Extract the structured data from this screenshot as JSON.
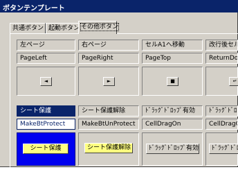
{
  "window": {
    "title": "ボタンテンプレート"
  },
  "tabs": [
    {
      "label": "共通ボタン",
      "active": false
    },
    {
      "label": "起動ボタン",
      "active": false
    },
    {
      "label": "その他ボタン",
      "active": true
    }
  ],
  "columns": [
    {
      "title": "左ページ",
      "macro": "PageLeft",
      "icon": "arrow-left-icon",
      "glyph": "◄"
    },
    {
      "title": "右ページ",
      "macro": "PageRight",
      "icon": "arrow-right-icon",
      "glyph": "►"
    },
    {
      "title": "セルA1へ移動",
      "macro": "PageTop",
      "icon": "square-stop-icon",
      "glyph": "■"
    },
    {
      "title": "改行後セル",
      "macro": "ReturnDow",
      "icon": "return-down-icon",
      "glyph": "↵"
    }
  ],
  "row2": [
    {
      "title": "シート保護",
      "macro": "MakeBtProtect",
      "button": "シート保護"
    },
    {
      "title": "シート保護解除",
      "macro": "MakeBtUnProtect",
      "button": "シート保護解除"
    },
    {
      "title": "ﾄﾞﾗｯｸﾞﾄﾞﾛｯﾌﾟ有効",
      "macro": "CellDragOn",
      "button": "ﾄﾞﾗｯｸﾞﾄﾞﾛｯﾌﾟ有効"
    },
    {
      "title": "ﾄﾞﾗｯｸﾞﾄﾞﾛｯﾌﾟ",
      "macro": "CellDragOf",
      "button": "ﾄﾞﾗｯｸﾞﾄﾞﾛｯﾌ"
    }
  ],
  "colors": {
    "selection": "#0a246a",
    "button_yellow": "#ffff80",
    "blue_fill": "#0000f0"
  }
}
